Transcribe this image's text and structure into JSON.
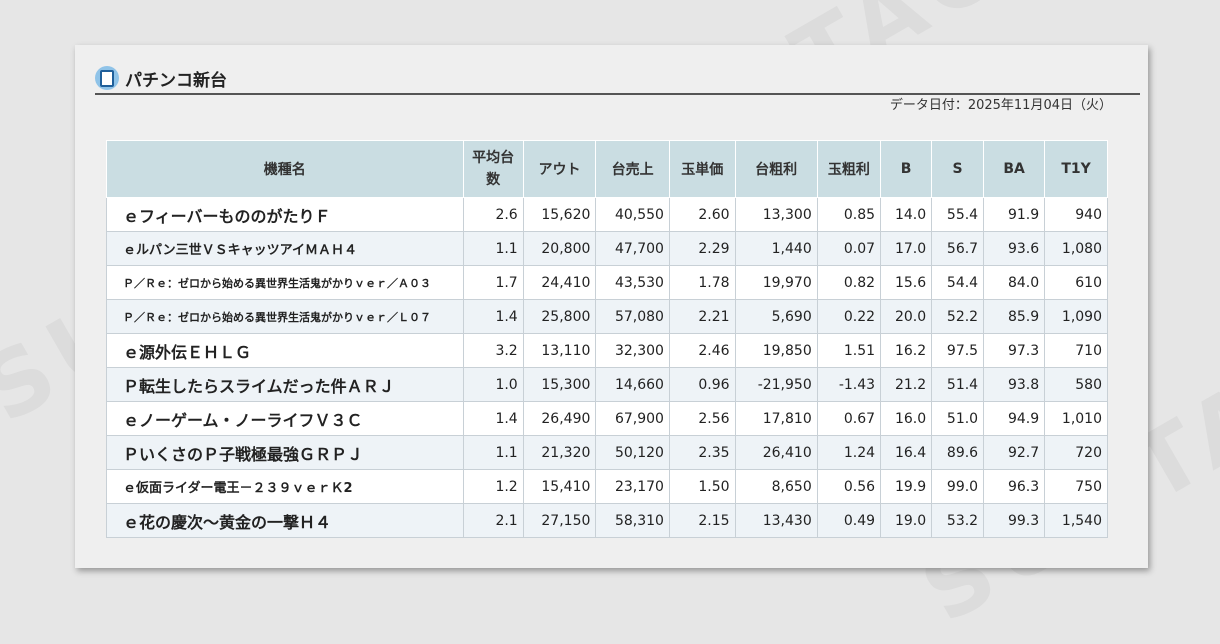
{
  "title": "パチンコ新台",
  "date": "データ日付：2025年11月04日（火）",
  "headers": [
    "機種名",
    "平均台数",
    "アウト",
    "台売上",
    "玉単価",
    "台粗利",
    "玉粗利",
    "B",
    "S",
    "BA",
    "T1Y"
  ],
  "rows": [
    [
      "ｅフィーバーもののがたりＦ",
      "2.6",
      "15,620",
      "40,550",
      "2.60",
      "13,300",
      "0.85",
      "14.0",
      "55.4",
      "91.9",
      "940"
    ],
    [
      "ｅルパン三世ＶＳキャッツアイＭＡＨ４",
      "1.1",
      "20,800",
      "47,700",
      "2.29",
      "1,440",
      "0.07",
      "17.0",
      "56.7",
      "93.6",
      "1,080"
    ],
    [
      "Ｐ／Ｒｅ：ゼロから始める異世界生活鬼がかりｖｅｒ／Ａ０３",
      "1.7",
      "24,410",
      "43,530",
      "1.78",
      "19,970",
      "0.82",
      "15.6",
      "54.4",
      "84.0",
      "610"
    ],
    [
      "Ｐ／Ｒｅ：ゼロから始める異世界生活鬼がかりｖｅｒ／Ｌ０７",
      "1.4",
      "25,800",
      "57,080",
      "2.21",
      "5,690",
      "0.22",
      "20.0",
      "52.2",
      "85.9",
      "1,090"
    ],
    [
      "ｅ源外伝ＥＨＬＧ",
      "3.2",
      "13,110",
      "32,300",
      "2.46",
      "19,850",
      "1.51",
      "16.2",
      "97.5",
      "97.3",
      "710"
    ],
    [
      "Ｐ転生したらスライムだった件ＡＲＪ",
      "1.0",
      "15,300",
      "14,660",
      "0.96",
      "-21,950",
      "-1.43",
      "21.2",
      "51.4",
      "93.8",
      "580"
    ],
    [
      "ｅノーゲーム・ノーライフＶ３Ｃ",
      "1.4",
      "26,490",
      "67,900",
      "2.56",
      "17,810",
      "0.67",
      "16.0",
      "51.0",
      "94.9",
      "1,010"
    ],
    [
      "ＰいくさのＰ子戦極最強ＧＲＰＪ",
      "1.1",
      "21,320",
      "50,120",
      "2.35",
      "26,410",
      "1.24",
      "16.4",
      "89.6",
      "92.7",
      "720"
    ],
    [
      "ｅ仮面ライダー電王－２３９ｖｅｒＫ2",
      "1.2",
      "15,410",
      "23,170",
      "1.50",
      "8,650",
      "0.56",
      "19.9",
      "99.0",
      "96.3",
      "750"
    ],
    [
      "ｅ花の慶次～黄金の一撃Ｈ４",
      "2.1",
      "27,150",
      "58,310",
      "2.15",
      "13,430",
      "0.49",
      "19.0",
      "53.2",
      "99.3",
      "1,540"
    ]
  ]
}
